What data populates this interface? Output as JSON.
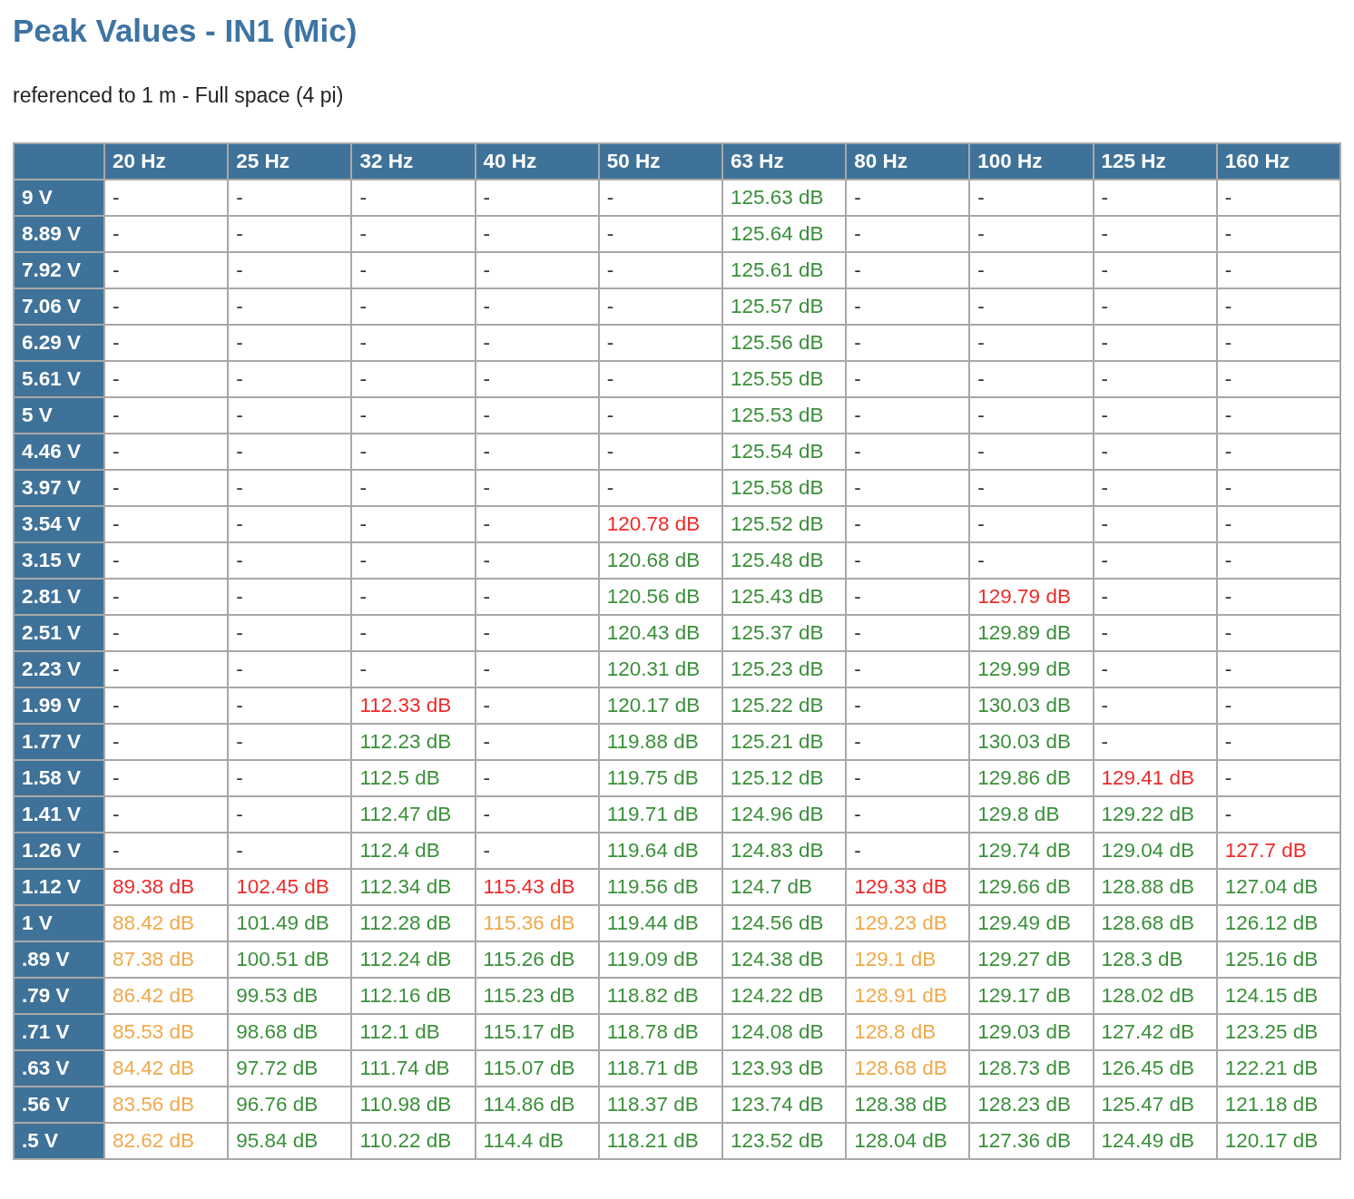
{
  "title": "Peak Values - IN1 (Mic)",
  "subtitle": "referenced to 1 m - Full space (4 pi)",
  "table": {
    "columns": [
      "20 Hz",
      "25 Hz",
      "32 Hz",
      "40 Hz",
      "50 Hz",
      "63 Hz",
      "80 Hz",
      "100 Hz",
      "125 Hz",
      "160 Hz"
    ],
    "rows": [
      {
        "label": "9 V",
        "cells": [
          {
            "text": "-"
          },
          {
            "text": "-"
          },
          {
            "text": "-"
          },
          {
            "text": "-"
          },
          {
            "text": "-"
          },
          {
            "text": "125.63 dB",
            "color": "#3a8f3a"
          },
          {
            "text": "-"
          },
          {
            "text": "-"
          },
          {
            "text": "-"
          },
          {
            "text": "-"
          }
        ]
      },
      {
        "label": "8.89 V",
        "cells": [
          {
            "text": "-"
          },
          {
            "text": "-"
          },
          {
            "text": "-"
          },
          {
            "text": "-"
          },
          {
            "text": "-"
          },
          {
            "text": "125.64 dB",
            "color": "#3a8f3a"
          },
          {
            "text": "-"
          },
          {
            "text": "-"
          },
          {
            "text": "-"
          },
          {
            "text": "-"
          }
        ]
      },
      {
        "label": "7.92 V",
        "cells": [
          {
            "text": "-"
          },
          {
            "text": "-"
          },
          {
            "text": "-"
          },
          {
            "text": "-"
          },
          {
            "text": "-"
          },
          {
            "text": "125.61 dB",
            "color": "#3a8f3a"
          },
          {
            "text": "-"
          },
          {
            "text": "-"
          },
          {
            "text": "-"
          },
          {
            "text": "-"
          }
        ]
      },
      {
        "label": "7.06 V",
        "cells": [
          {
            "text": "-"
          },
          {
            "text": "-"
          },
          {
            "text": "-"
          },
          {
            "text": "-"
          },
          {
            "text": "-"
          },
          {
            "text": "125.57 dB",
            "color": "#3a8f3a"
          },
          {
            "text": "-"
          },
          {
            "text": "-"
          },
          {
            "text": "-"
          },
          {
            "text": "-"
          }
        ]
      },
      {
        "label": "6.29 V",
        "cells": [
          {
            "text": "-"
          },
          {
            "text": "-"
          },
          {
            "text": "-"
          },
          {
            "text": "-"
          },
          {
            "text": "-"
          },
          {
            "text": "125.56 dB",
            "color": "#3a8f3a"
          },
          {
            "text": "-"
          },
          {
            "text": "-"
          },
          {
            "text": "-"
          },
          {
            "text": "-"
          }
        ]
      },
      {
        "label": "5.61 V",
        "cells": [
          {
            "text": "-"
          },
          {
            "text": "-"
          },
          {
            "text": "-"
          },
          {
            "text": "-"
          },
          {
            "text": "-"
          },
          {
            "text": "125.55 dB",
            "color": "#3a8f3a"
          },
          {
            "text": "-"
          },
          {
            "text": "-"
          },
          {
            "text": "-"
          },
          {
            "text": "-"
          }
        ]
      },
      {
        "label": "5 V",
        "cells": [
          {
            "text": "-"
          },
          {
            "text": "-"
          },
          {
            "text": "-"
          },
          {
            "text": "-"
          },
          {
            "text": "-"
          },
          {
            "text": "125.53 dB",
            "color": "#3a8f3a"
          },
          {
            "text": "-"
          },
          {
            "text": "-"
          },
          {
            "text": "-"
          },
          {
            "text": "-"
          }
        ]
      },
      {
        "label": "4.46 V",
        "cells": [
          {
            "text": "-"
          },
          {
            "text": "-"
          },
          {
            "text": "-"
          },
          {
            "text": "-"
          },
          {
            "text": "-"
          },
          {
            "text": "125.54 dB",
            "color": "#3a8f3a"
          },
          {
            "text": "-"
          },
          {
            "text": "-"
          },
          {
            "text": "-"
          },
          {
            "text": "-"
          }
        ]
      },
      {
        "label": "3.97 V",
        "cells": [
          {
            "text": "-"
          },
          {
            "text": "-"
          },
          {
            "text": "-"
          },
          {
            "text": "-"
          },
          {
            "text": "-"
          },
          {
            "text": "125.58 dB",
            "color": "#3a8f3a"
          },
          {
            "text": "-"
          },
          {
            "text": "-"
          },
          {
            "text": "-"
          },
          {
            "text": "-"
          }
        ]
      },
      {
        "label": "3.54 V",
        "cells": [
          {
            "text": "-"
          },
          {
            "text": "-"
          },
          {
            "text": "-"
          },
          {
            "text": "-"
          },
          {
            "text": "120.78 dB",
            "color": "#ee2a2a"
          },
          {
            "text": "125.52 dB",
            "color": "#3a8f3a"
          },
          {
            "text": "-"
          },
          {
            "text": "-"
          },
          {
            "text": "-"
          },
          {
            "text": "-"
          }
        ]
      },
      {
        "label": "3.15 V",
        "cells": [
          {
            "text": "-"
          },
          {
            "text": "-"
          },
          {
            "text": "-"
          },
          {
            "text": "-"
          },
          {
            "text": "120.68 dB",
            "color": "#3a8f3a"
          },
          {
            "text": "125.48 dB",
            "color": "#3a8f3a"
          },
          {
            "text": "-"
          },
          {
            "text": "-"
          },
          {
            "text": "-"
          },
          {
            "text": "-"
          }
        ]
      },
      {
        "label": "2.81 V",
        "cells": [
          {
            "text": "-"
          },
          {
            "text": "-"
          },
          {
            "text": "-"
          },
          {
            "text": "-"
          },
          {
            "text": "120.56 dB",
            "color": "#3a8f3a"
          },
          {
            "text": "125.43 dB",
            "color": "#3a8f3a"
          },
          {
            "text": "-"
          },
          {
            "text": "129.79 dB",
            "color": "#ee2a2a"
          },
          {
            "text": "-"
          },
          {
            "text": "-"
          }
        ]
      },
      {
        "label": "2.51 V",
        "cells": [
          {
            "text": "-"
          },
          {
            "text": "-"
          },
          {
            "text": "-"
          },
          {
            "text": "-"
          },
          {
            "text": "120.43 dB",
            "color": "#3a8f3a"
          },
          {
            "text": "125.37 dB",
            "color": "#3a8f3a"
          },
          {
            "text": "-"
          },
          {
            "text": "129.89 dB",
            "color": "#3a8f3a"
          },
          {
            "text": "-"
          },
          {
            "text": "-"
          }
        ]
      },
      {
        "label": "2.23 V",
        "cells": [
          {
            "text": "-"
          },
          {
            "text": "-"
          },
          {
            "text": "-"
          },
          {
            "text": "-"
          },
          {
            "text": "120.31 dB",
            "color": "#3a8f3a"
          },
          {
            "text": "125.23 dB",
            "color": "#3a8f3a"
          },
          {
            "text": "-"
          },
          {
            "text": "129.99 dB",
            "color": "#3a8f3a"
          },
          {
            "text": "-"
          },
          {
            "text": "-"
          }
        ]
      },
      {
        "label": "1.99 V",
        "cells": [
          {
            "text": "-"
          },
          {
            "text": "-"
          },
          {
            "text": "112.33 dB",
            "color": "#ee2a2a"
          },
          {
            "text": "-"
          },
          {
            "text": "120.17 dB",
            "color": "#3a8f3a"
          },
          {
            "text": "125.22 dB",
            "color": "#3a8f3a"
          },
          {
            "text": "-"
          },
          {
            "text": "130.03 dB",
            "color": "#3a8f3a"
          },
          {
            "text": "-"
          },
          {
            "text": "-"
          }
        ]
      },
      {
        "label": "1.77 V",
        "cells": [
          {
            "text": "-"
          },
          {
            "text": "-"
          },
          {
            "text": "112.23 dB",
            "color": "#3a8f3a"
          },
          {
            "text": "-"
          },
          {
            "text": "119.88 dB",
            "color": "#3a8f3a"
          },
          {
            "text": "125.21 dB",
            "color": "#3a8f3a"
          },
          {
            "text": "-"
          },
          {
            "text": "130.03 dB",
            "color": "#3a8f3a"
          },
          {
            "text": "-"
          },
          {
            "text": "-"
          }
        ]
      },
      {
        "label": "1.58 V",
        "cells": [
          {
            "text": "-"
          },
          {
            "text": "-"
          },
          {
            "text": "112.5 dB",
            "color": "#3a8f3a"
          },
          {
            "text": "-"
          },
          {
            "text": "119.75 dB",
            "color": "#3a8f3a"
          },
          {
            "text": "125.12 dB",
            "color": "#3a8f3a"
          },
          {
            "text": "-"
          },
          {
            "text": "129.86 dB",
            "color": "#3a8f3a"
          },
          {
            "text": "129.41 dB",
            "color": "#ee2a2a"
          },
          {
            "text": "-"
          }
        ]
      },
      {
        "label": "1.41 V",
        "cells": [
          {
            "text": "-"
          },
          {
            "text": "-"
          },
          {
            "text": "112.47 dB",
            "color": "#3a8f3a"
          },
          {
            "text": "-"
          },
          {
            "text": "119.71 dB",
            "color": "#3a8f3a"
          },
          {
            "text": "124.96 dB",
            "color": "#3a8f3a"
          },
          {
            "text": "-"
          },
          {
            "text": "129.8 dB",
            "color": "#3a8f3a"
          },
          {
            "text": "129.22 dB",
            "color": "#3a8f3a"
          },
          {
            "text": "-"
          }
        ]
      },
      {
        "label": "1.26 V",
        "cells": [
          {
            "text": "-"
          },
          {
            "text": "-"
          },
          {
            "text": "112.4 dB",
            "color": "#3a8f3a"
          },
          {
            "text": "-"
          },
          {
            "text": "119.64 dB",
            "color": "#3a8f3a"
          },
          {
            "text": "124.83 dB",
            "color": "#3a8f3a"
          },
          {
            "text": "-"
          },
          {
            "text": "129.74 dB",
            "color": "#3a8f3a"
          },
          {
            "text": "129.04 dB",
            "color": "#3a8f3a"
          },
          {
            "text": "127.7 dB",
            "color": "#ee2a2a"
          }
        ]
      },
      {
        "label": "1.12 V",
        "cells": [
          {
            "text": "89.38 dB",
            "color": "#ee2a2a"
          },
          {
            "text": "102.45 dB",
            "color": "#ee2a2a"
          },
          {
            "text": "112.34 dB",
            "color": "#3a8f3a"
          },
          {
            "text": "115.43 dB",
            "color": "#ee2a2a"
          },
          {
            "text": "119.56 dB",
            "color": "#3a8f3a"
          },
          {
            "text": "124.7 dB",
            "color": "#3a8f3a"
          },
          {
            "text": "129.33 dB",
            "color": "#ee2a2a"
          },
          {
            "text": "129.66 dB",
            "color": "#3a8f3a"
          },
          {
            "text": "128.88 dB",
            "color": "#3a8f3a"
          },
          {
            "text": "127.04 dB",
            "color": "#3a8f3a"
          }
        ]
      },
      {
        "label": "1 V",
        "cells": [
          {
            "text": "88.42 dB",
            "color": "#f0a94a"
          },
          {
            "text": "101.49 dB",
            "color": "#3a8f3a"
          },
          {
            "text": "112.28 dB",
            "color": "#3a8f3a"
          },
          {
            "text": "115.36 dB",
            "color": "#f0a94a"
          },
          {
            "text": "119.44 dB",
            "color": "#3a8f3a"
          },
          {
            "text": "124.56 dB",
            "color": "#3a8f3a"
          },
          {
            "text": "129.23 dB",
            "color": "#f0a94a"
          },
          {
            "text": "129.49 dB",
            "color": "#3a8f3a"
          },
          {
            "text": "128.68 dB",
            "color": "#3a8f3a"
          },
          {
            "text": "126.12 dB",
            "color": "#3a8f3a"
          }
        ]
      },
      {
        "label": ".89 V",
        "cells": [
          {
            "text": "87.38 dB",
            "color": "#f0a94a"
          },
          {
            "text": "100.51 dB",
            "color": "#3a8f3a"
          },
          {
            "text": "112.24 dB",
            "color": "#3a8f3a"
          },
          {
            "text": "115.26 dB",
            "color": "#3a8f3a"
          },
          {
            "text": "119.09 dB",
            "color": "#3a8f3a"
          },
          {
            "text": "124.38 dB",
            "color": "#3a8f3a"
          },
          {
            "text": "129.1 dB",
            "color": "#f0a94a"
          },
          {
            "text": "129.27 dB",
            "color": "#3a8f3a"
          },
          {
            "text": "128.3 dB",
            "color": "#3a8f3a"
          },
          {
            "text": "125.16 dB",
            "color": "#3a8f3a"
          }
        ]
      },
      {
        "label": ".79 V",
        "cells": [
          {
            "text": "86.42 dB",
            "color": "#f0a94a"
          },
          {
            "text": "99.53 dB",
            "color": "#3a8f3a"
          },
          {
            "text": "112.16 dB",
            "color": "#3a8f3a"
          },
          {
            "text": "115.23 dB",
            "color": "#3a8f3a"
          },
          {
            "text": "118.82 dB",
            "color": "#3a8f3a"
          },
          {
            "text": "124.22 dB",
            "color": "#3a8f3a"
          },
          {
            "text": "128.91 dB",
            "color": "#f0a94a"
          },
          {
            "text": "129.17 dB",
            "color": "#3a8f3a"
          },
          {
            "text": "128.02 dB",
            "color": "#3a8f3a"
          },
          {
            "text": "124.15 dB",
            "color": "#3a8f3a"
          }
        ]
      },
      {
        "label": ".71 V",
        "cells": [
          {
            "text": "85.53 dB",
            "color": "#f0a94a"
          },
          {
            "text": "98.68 dB",
            "color": "#3a8f3a"
          },
          {
            "text": "112.1 dB",
            "color": "#3a8f3a"
          },
          {
            "text": "115.17 dB",
            "color": "#3a8f3a"
          },
          {
            "text": "118.78 dB",
            "color": "#3a8f3a"
          },
          {
            "text": "124.08 dB",
            "color": "#3a8f3a"
          },
          {
            "text": "128.8 dB",
            "color": "#f0a94a"
          },
          {
            "text": "129.03 dB",
            "color": "#3a8f3a"
          },
          {
            "text": "127.42 dB",
            "color": "#3a8f3a"
          },
          {
            "text": "123.25 dB",
            "color": "#3a8f3a"
          }
        ]
      },
      {
        "label": ".63 V",
        "cells": [
          {
            "text": "84.42 dB",
            "color": "#f0a94a"
          },
          {
            "text": "97.72 dB",
            "color": "#3a8f3a"
          },
          {
            "text": "111.74 dB",
            "color": "#3a8f3a"
          },
          {
            "text": "115.07 dB",
            "color": "#3a8f3a"
          },
          {
            "text": "118.71 dB",
            "color": "#3a8f3a"
          },
          {
            "text": "123.93 dB",
            "color": "#3a8f3a"
          },
          {
            "text": "128.68 dB",
            "color": "#f0a94a"
          },
          {
            "text": "128.73 dB",
            "color": "#3a8f3a"
          },
          {
            "text": "126.45 dB",
            "color": "#3a8f3a"
          },
          {
            "text": "122.21 dB",
            "color": "#3a8f3a"
          }
        ]
      },
      {
        "label": ".56 V",
        "cells": [
          {
            "text": "83.56 dB",
            "color": "#f0a94a"
          },
          {
            "text": "96.76 dB",
            "color": "#3a8f3a"
          },
          {
            "text": "110.98 dB",
            "color": "#3a8f3a"
          },
          {
            "text": "114.86 dB",
            "color": "#3a8f3a"
          },
          {
            "text": "118.37 dB",
            "color": "#3a8f3a"
          },
          {
            "text": "123.74 dB",
            "color": "#3a8f3a"
          },
          {
            "text": "128.38 dB",
            "color": "#3a8f3a"
          },
          {
            "text": "128.23 dB",
            "color": "#3a8f3a"
          },
          {
            "text": "125.47 dB",
            "color": "#3a8f3a"
          },
          {
            "text": "121.18 dB",
            "color": "#3a8f3a"
          }
        ]
      },
      {
        "label": ".5 V",
        "cells": [
          {
            "text": "82.62 dB",
            "color": "#f0a94a"
          },
          {
            "text": "95.84 dB",
            "color": "#3a8f3a"
          },
          {
            "text": "110.22 dB",
            "color": "#3a8f3a"
          },
          {
            "text": "114.4 dB",
            "color": "#3a8f3a"
          },
          {
            "text": "118.21 dB",
            "color": "#3a8f3a"
          },
          {
            "text": "123.52 dB",
            "color": "#3a8f3a"
          },
          {
            "text": "128.04 dB",
            "color": "#3a8f3a"
          },
          {
            "text": "127.36 dB",
            "color": "#3a8f3a"
          },
          {
            "text": "124.49 dB",
            "color": "#3a8f3a"
          },
          {
            "text": "120.17 dB",
            "color": "#3a8f3a"
          }
        ]
      }
    ]
  }
}
